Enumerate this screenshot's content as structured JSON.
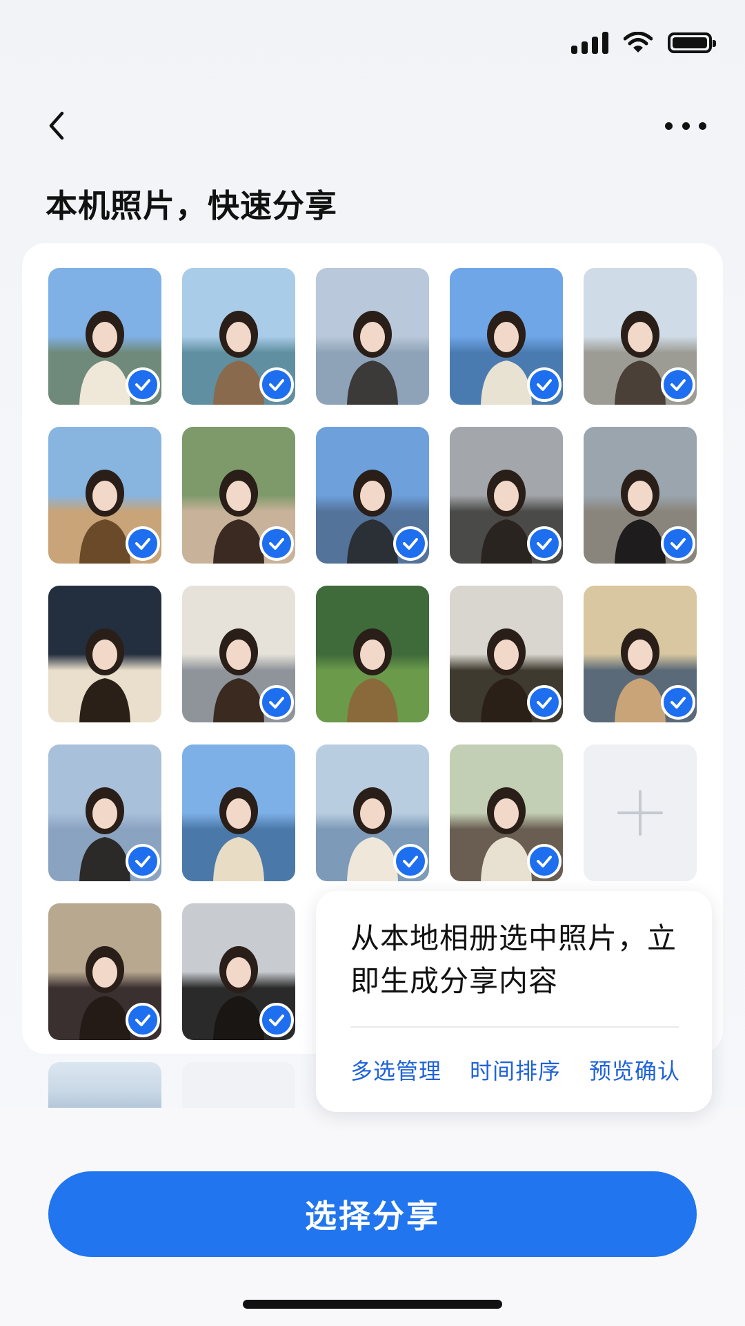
{
  "header": {
    "title": "本机照片，快速分享"
  },
  "photos": [
    {
      "scene": "wedding-veil-lakeside",
      "sky": "#7fb0e6",
      "ground": "#6f8a7a",
      "figure": "#efe7d8",
      "selected": true
    },
    {
      "scene": "woman-flowers-lake",
      "sky": "#a9cce8",
      "ground": "#5f8fa0",
      "figure": "#8a6a4c",
      "selected": true
    },
    {
      "scene": "deck-chairs-lake",
      "sky": "#b9c8da",
      "ground": "#8ea3b8",
      "figure": "#3b3a38",
      "selected": false
    },
    {
      "scene": "woman-seaside-meadow",
      "sky": "#6fa6e8",
      "ground": "#4a7bb0",
      "figure": "#e8e2d2",
      "selected": true
    },
    {
      "scene": "group-photo-tree",
      "sky": "#cfdbe6",
      "ground": "#9c9c94",
      "figure": "#4a4038",
      "selected": true
    },
    {
      "scene": "gazebo-terrace",
      "sky": "#88b4e0",
      "ground": "#c8a478",
      "figure": "#6b4a2a",
      "selected": true
    },
    {
      "scene": "portrait-smile-green",
      "sky": "#7e9a6a",
      "ground": "#c9b29a",
      "figure": "#3a2a22",
      "selected": true
    },
    {
      "scene": "man-by-sea",
      "sky": "#6ea0dc",
      "ground": "#54739a",
      "figure": "#2b2f36",
      "selected": true
    },
    {
      "scene": "portrait-car",
      "sky": "#a3a6aa",
      "ground": "#4a4a48",
      "figure": "#2a2420",
      "selected": true
    },
    {
      "scene": "street-black-coat",
      "sky": "#9aa5ae",
      "ground": "#8a857c",
      "figure": "#1e1c1c",
      "selected": true
    },
    {
      "scene": "portrait-dark-bg",
      "sky": "#232e3e",
      "ground": "#e9dfcc",
      "figure": "#2b2018",
      "selected": false
    },
    {
      "scene": "portrait-denim",
      "sky": "#e6e2da",
      "ground": "#8f949a",
      "figure": "#3a2a20",
      "selected": true
    },
    {
      "scene": "walking-on-lawn",
      "sky": "#3f6a3a",
      "ground": "#6a9a4a",
      "figure": "#8a6a3a",
      "selected": false
    },
    {
      "scene": "portrait-jacket",
      "sky": "#d9d6cf",
      "ground": "#3e3a30",
      "figure": "#2a2018",
      "selected": true
    },
    {
      "scene": "lake-rocks-sunset",
      "sky": "#d8c7a0",
      "ground": "#5a6a78",
      "figure": "#c8a478",
      "selected": true
    },
    {
      "scene": "deck-chair-sea",
      "sky": "#a9c0da",
      "ground": "#8aa3c0",
      "figure": "#2b2a28",
      "selected": true
    },
    {
      "scene": "pier-standing",
      "sky": "#7eb0e8",
      "ground": "#4a78a8",
      "figure": "#e8dcc4",
      "selected": false
    },
    {
      "scene": "winter-trees-path",
      "sky": "#b8cde0",
      "ground": "#7d9ab8",
      "figure": "#efe8da",
      "selected": true
    },
    {
      "scene": "cafe-sitting",
      "sky": "#c2cfb4",
      "ground": "#6a5e52",
      "figure": "#e8e0d0",
      "selected": true
    },
    {
      "scene": "palm-portrait",
      "sky": "#b8a890",
      "ground": "#3a3030",
      "figure": "#241a16",
      "selected": true
    },
    {
      "scene": "restaurant-portrait",
      "sky": "#c8ccd0",
      "ground": "#2a2a2a",
      "figure": "#1a1614",
      "selected": true
    }
  ],
  "add_photo": {
    "icon": "plus-icon"
  },
  "tooltip": {
    "text": "从本地相册选中照片，立即生成分享内容",
    "actions": [
      "多选管理",
      "时间排序",
      "预览确认"
    ]
  },
  "primary_button": {
    "label": "选择分享"
  },
  "colors": {
    "accent": "#2175ee",
    "check": "#1e6ef0",
    "link": "#1f62d8"
  }
}
